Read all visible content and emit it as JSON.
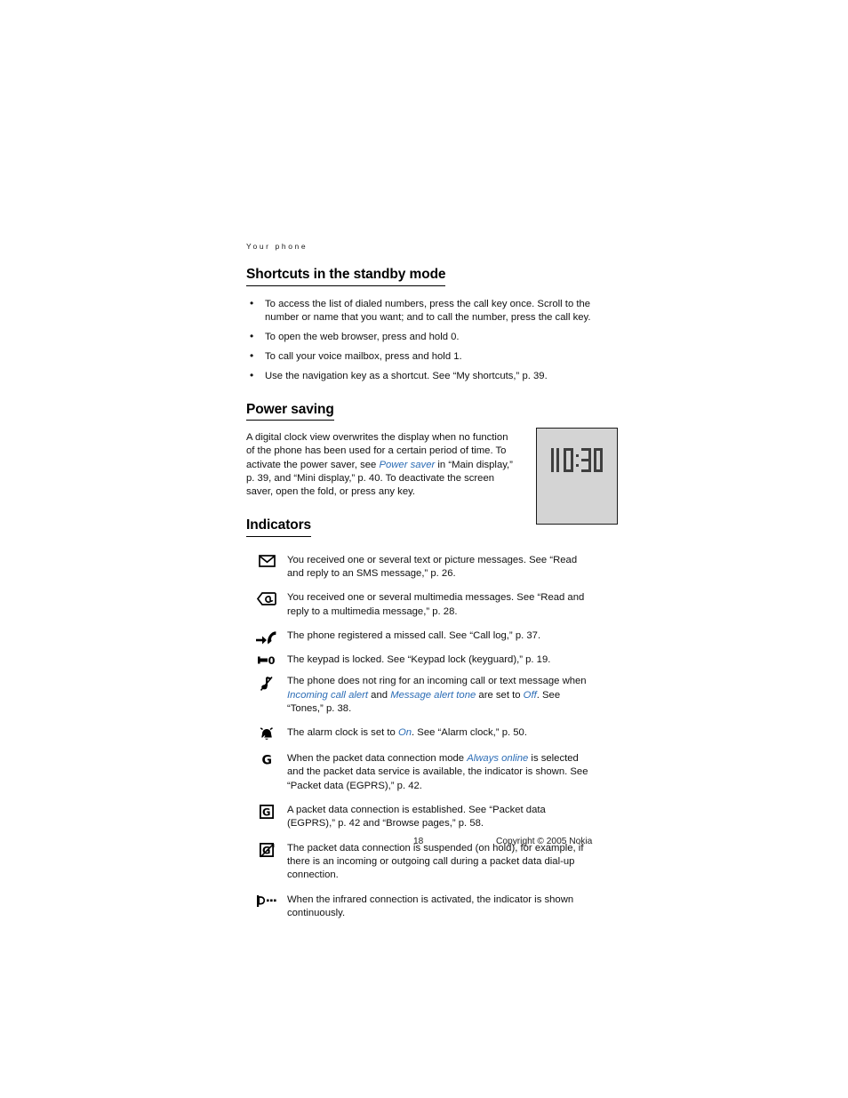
{
  "document": {
    "running_header": "Your phone",
    "page_number": "18",
    "copyright": "Copyright © 2005 Nokia",
    "link_color": "#2b6cb5"
  },
  "shortcuts": {
    "heading": "Shortcuts in the standby mode",
    "items": [
      "To access the list of dialed numbers, press the call key once. Scroll to the number or name that you want; and to call the number, press the call key.",
      "To open the web browser, press and hold 0.",
      "To call your voice mailbox, press and hold 1.",
      "Use the navigation key as a shortcut. See “My shortcuts,” p. 39."
    ]
  },
  "power_saving": {
    "heading": "Power saving",
    "paragraph_part1": "A digital clock view overwrites the display when no function of the phone has been used for a certain period of time. To activate the power saver, see ",
    "link_text": "Power saver",
    "paragraph_part2": " in “Main display,” p. 39, and “Mini display,” p. 40. To deactivate the screen saver, open the fold, or press any key.",
    "figure": {
      "name": "digital-clock-display",
      "time": "10:30",
      "background_color": "#d4d4d4",
      "digit_color": "#3f3f3f"
    }
  },
  "indicators": {
    "heading": "Indicators",
    "items": [
      {
        "icon": "envelope-icon",
        "text": "You received one or several text or picture messages. See “Read and reply to an SMS message,” p. 26."
      },
      {
        "icon": "multimedia-message-icon",
        "text": "You received one or several multimedia messages. See “Read and reply to a multimedia message,” p. 28."
      },
      {
        "icon": "missed-call-icon",
        "text": "The phone registered a missed call. See “Call log,” p. 37."
      },
      {
        "icon": "keypad-lock-icon",
        "text": "The keypad is locked. See “Keypad lock (keyguard),” p. 19."
      },
      {
        "icon": "silent-mode-icon",
        "text_part1": "The phone does not ring for an incoming call or text message when ",
        "link1": "Incoming call alert",
        "text_part2": " and ",
        "link2": "Message alert tone",
        "text_part3": " are set to ",
        "link3": "Off",
        "text_part4": ". See “Tones,” p. 38."
      },
      {
        "icon": "alarm-clock-icon",
        "text_part1": "The alarm clock is set to ",
        "link1": "On",
        "text_part2": ". See “Alarm clock,” p. 50."
      },
      {
        "icon": "gprs-available-icon",
        "text_part1": "When the packet data connection mode ",
        "link1": "Always online",
        "text_part2": " is selected and the packet data service is available, the indicator is shown. See “Packet data (EGPRS),” p. 42."
      },
      {
        "icon": "gprs-connected-icon",
        "text": "A packet data connection is established. See “Packet data (EGPRS),” p. 42 and “Browse pages,” p. 58."
      },
      {
        "icon": "gprs-suspended-icon",
        "text": "The packet data connection is suspended (on hold), for example, if there is an incoming or outgoing call during a packet data dial-up connection."
      },
      {
        "icon": "infrared-icon",
        "text": "When the infrared connection is activated, the indicator is shown continuously."
      }
    ]
  }
}
